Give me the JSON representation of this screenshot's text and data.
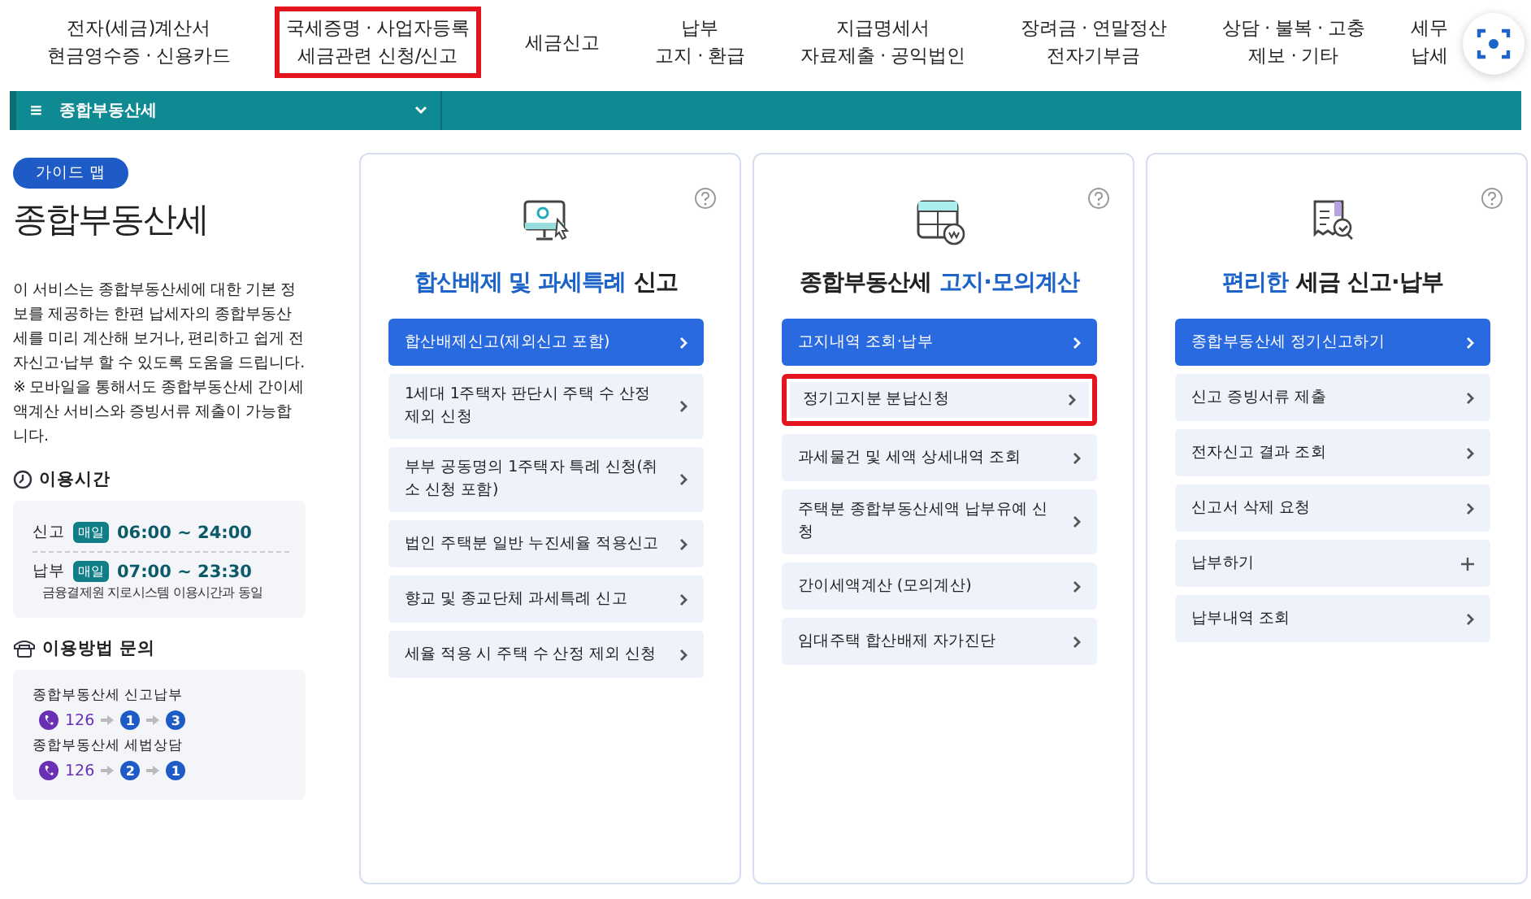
{
  "top_nav": [
    {
      "lines": [
        "전자(세금)계산서",
        "현금영수증 · 신용카드"
      ],
      "highlighted": false
    },
    {
      "lines": [
        "국세증명 · 사업자등록",
        "세금관련 신청/신고"
      ],
      "highlighted": true
    },
    {
      "lines": [
        "세금신고"
      ],
      "highlighted": false
    },
    {
      "lines": [
        "납부",
        "고지 · 환급"
      ],
      "highlighted": false
    },
    {
      "lines": [
        "지급명세서",
        "자료제출 · 공익법인"
      ],
      "highlighted": false
    },
    {
      "lines": [
        "장려금 · 연말정산",
        "전자기부금"
      ],
      "highlighted": false
    },
    {
      "lines": [
        "상담 · 불복 · 고충",
        "제보 · 기타"
      ],
      "highlighted": false
    },
    {
      "lines": [
        "세무",
        "납세"
      ],
      "highlighted": false
    }
  ],
  "breadcrumb": {
    "menu_glyph": "≡",
    "label": "종합부동산세"
  },
  "sidebar": {
    "badge": "가이드 맵",
    "title": "종합부동산세",
    "description": "이 서비스는 종합부동산세에 대한 기본 정보를 제공하는 한편 납세자의 종합부동산세를 미리 계산해 보거나, 편리하고 쉽게 전자신고·납부 할 수 있도록 도움을 드립니다.",
    "notice": "※ 모바일을 통해서도 종합부동산세 간이세액계산 서비스와 증빙서류 제출이 가능합니다.",
    "hours": {
      "heading": "이용시간",
      "rows": [
        {
          "label": "신고",
          "badge": "매일",
          "time": "06:00 ~ 24:00"
        },
        {
          "label": "납부",
          "badge": "매일",
          "time": "07:00 ~ 23:30",
          "note": "금융결제원 지로시스템 이용시간과 동일"
        }
      ]
    },
    "contact": {
      "heading": "이용방법 문의",
      "items": [
        {
          "label": "종합부동산세 신고납부",
          "number": "126",
          "steps": [
            "1",
            "3"
          ]
        },
        {
          "label": "종합부동산세 세법상담",
          "number": "126",
          "steps": [
            "2",
            "1"
          ]
        }
      ]
    }
  },
  "cards": [
    {
      "title": [
        {
          "text": "합산배제 및 과세특례",
          "accent": true
        },
        {
          "text": "신고",
          "accent": false
        }
      ],
      "items": [
        {
          "label": "합산배제신고(제외신고 포함)",
          "primary": true,
          "kind": "link",
          "highlighted": false
        },
        {
          "label": "1세대 1주택자 판단시 주택 수 산정 제외 신청",
          "primary": false,
          "kind": "link",
          "highlighted": false
        },
        {
          "label": "부부 공동명의 1주택자 특례 신청(취소 신청 포함)",
          "primary": false,
          "kind": "link",
          "highlighted": false
        },
        {
          "label": "법인 주택분 일반 누진세율 적용신고",
          "primary": false,
          "kind": "link",
          "highlighted": false
        },
        {
          "label": "향교 및 종교단체 과세특례 신고",
          "primary": false,
          "kind": "link",
          "highlighted": false
        },
        {
          "label": "세율 적용 시 주택 수 산정 제외 신청",
          "primary": false,
          "kind": "link",
          "highlighted": false
        }
      ]
    },
    {
      "title": [
        {
          "text": "종합부동산세",
          "accent": false
        },
        {
          "text": "고지·모의계산",
          "accent": true
        }
      ],
      "items": [
        {
          "label": "고지내역 조회·납부",
          "primary": true,
          "kind": "link",
          "highlighted": false
        },
        {
          "label": "정기고지분 분납신청",
          "primary": false,
          "kind": "link",
          "highlighted": true
        },
        {
          "label": "과세물건 및 세액 상세내역 조회",
          "primary": false,
          "kind": "link",
          "highlighted": false
        },
        {
          "label": "주택분 종합부동산세액 납부유예 신청",
          "primary": false,
          "kind": "link",
          "highlighted": false
        },
        {
          "label": "간이세액계산 (모의계산)",
          "primary": false,
          "kind": "link",
          "highlighted": false
        },
        {
          "label": "임대주택 합산배제 자가진단",
          "primary": false,
          "kind": "link",
          "highlighted": false
        }
      ]
    },
    {
      "title": [
        {
          "text": "편리한",
          "accent": true
        },
        {
          "text": "세금 신고·납부",
          "accent": false
        }
      ],
      "items": [
        {
          "label": "종합부동산세 정기신고하기",
          "primary": true,
          "kind": "link",
          "highlighted": false
        },
        {
          "label": "신고 증빙서류 제출",
          "primary": false,
          "kind": "link",
          "highlighted": false
        },
        {
          "label": "전자신고 결과 조회",
          "primary": false,
          "kind": "link",
          "highlighted": false
        },
        {
          "label": "신고서 삭제 요청",
          "primary": false,
          "kind": "link",
          "highlighted": false
        },
        {
          "label": "납부하기",
          "primary": false,
          "kind": "expand",
          "highlighted": false
        },
        {
          "label": "납부내역 조회",
          "primary": false,
          "kind": "link",
          "highlighted": false
        }
      ]
    }
  ]
}
